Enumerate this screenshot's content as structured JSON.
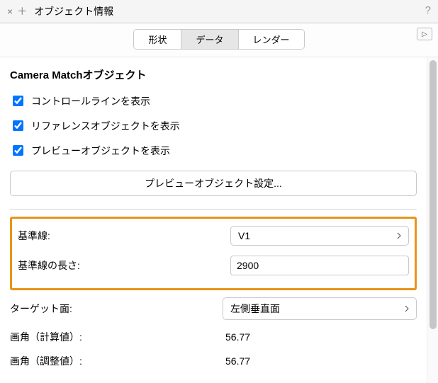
{
  "window": {
    "title": "オブジェクト情報"
  },
  "tabs": {
    "shape": "形状",
    "data": "データ",
    "render": "レンダー"
  },
  "section_title": "Camera Matchオブジェクト",
  "checks": {
    "control_lines": "コントロールラインを表示",
    "reference_object": "リファレンスオブジェクトを表示",
    "preview_object": "プレビューオブジェクトを表示"
  },
  "preview_button": "プレビューオブジェクト設定...",
  "fields": {
    "baseline_label": "基準線:",
    "baseline_value": "V1",
    "baseline_length_label": "基準線の長さ:",
    "baseline_length_value": "2900",
    "target_face_label": "ターゲット面:",
    "target_face_value": "左側垂直面",
    "fov_calc_label": "画角（計算値）:",
    "fov_calc_value": "56.77",
    "fov_adj_label": "画角（調整値）:",
    "fov_adj_value": "56.77"
  }
}
